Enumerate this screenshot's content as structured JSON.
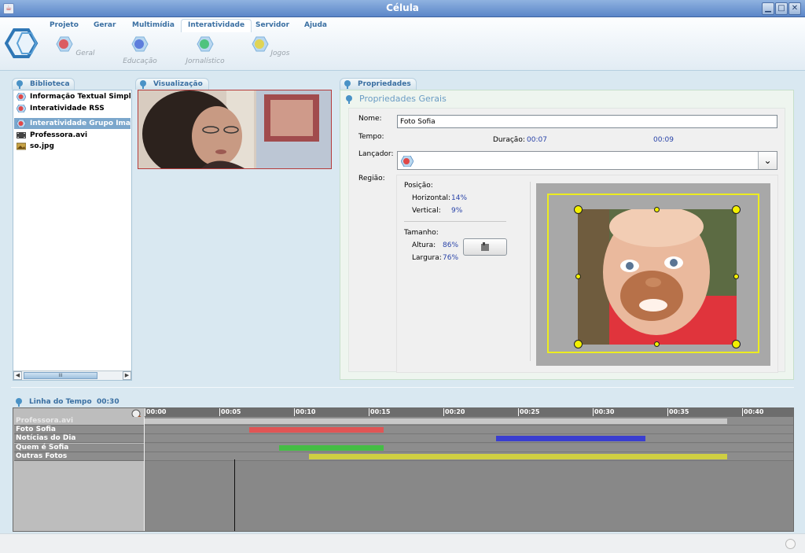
{
  "window": {
    "title": "Célula"
  },
  "menu": [
    "Projeto",
    "Gerar",
    "Multimídia",
    "Interatividade",
    "Servidor",
    "Ajuda"
  ],
  "ribbon_tools": [
    {
      "label": "Geral",
      "color": "#e04848"
    },
    {
      "label": "Educação",
      "color": "#4c6fd8"
    },
    {
      "label": "Jornalístico",
      "color": "#3cc06a"
    },
    {
      "label": "Jogos",
      "color": "#e6d43a"
    }
  ],
  "library": {
    "tab": "Biblioteca",
    "items": [
      {
        "label": "Informação Textual Simples com",
        "icon": "interactivity-icon",
        "selected": false
      },
      {
        "label": "Interatividade RSS",
        "icon": "interactivity-icon",
        "selected": false
      },
      {
        "label": "Interatividade Grupo Imagens",
        "icon": "interactivity-icon",
        "selected": true
      },
      {
        "label": "Professora.avi",
        "icon": "video-file-icon",
        "selected": false
      },
      {
        "label": "so.jpg",
        "icon": "image-file-icon",
        "selected": false
      }
    ],
    "scroll_grip": "III"
  },
  "preview": {
    "tab": "Visualização"
  },
  "properties": {
    "tab": "Propriedades",
    "section_title": "Propriedades Gerais",
    "name_label": "Nome:",
    "name_value": "Foto Sofia",
    "time_label": "Tempo:",
    "duration_label": "Duração:",
    "duration_start": "00:07",
    "duration_end": "00:09",
    "launcher_label": "Lançador:",
    "region_label": "Região:",
    "position_label": "Posição:",
    "horizontal_label": "Horizontal:",
    "horizontal_value": "14%",
    "vertical_label": "Vertical:",
    "vertical_value": "9%",
    "size_label": "Tamanho:",
    "height_label": "Altura:",
    "height_value": "86%",
    "width_label": "Largura:",
    "width_value": "76%"
  },
  "timeline": {
    "title": "Linha do Tempo",
    "duration": "00:30",
    "ticks": [
      "00:00",
      "00:05",
      "00:10",
      "00:15",
      "00:20",
      "00:25",
      "00:30",
      "00:35",
      "00:40"
    ],
    "tracks": [
      {
        "label": "Professora.avi",
        "color": "#c8c8c8",
        "start": 0,
        "end": 39
      },
      {
        "label": "Foto Sofia",
        "color": "#e05555",
        "start": 7,
        "end": 16
      },
      {
        "label": "Notícias do Dia",
        "color": "#3a3ed0",
        "start": 23.5,
        "end": 33.5
      },
      {
        "label": "Quem é Sofia",
        "color": "#45bd45",
        "start": 9,
        "end": 16
      },
      {
        "label": "Outras Fotos",
        "color": "#cfcf42",
        "start": 11,
        "end": 39
      }
    ],
    "playhead": 6
  }
}
